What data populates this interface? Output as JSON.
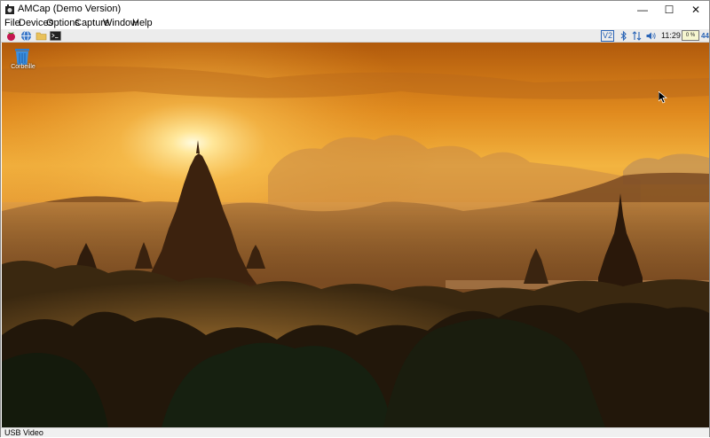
{
  "window": {
    "title": "AMCap (Demo Version)",
    "minimize_glyph": "—",
    "maximize_glyph": "☐",
    "close_glyph": "✕"
  },
  "menu": {
    "items": [
      {
        "label": "File"
      },
      {
        "label": "Devices"
      },
      {
        "label": "Options"
      },
      {
        "label": "Capture"
      },
      {
        "label": "Window"
      },
      {
        "label": "Help"
      }
    ]
  },
  "taskbar": {
    "launchers": [
      "raspberry-icon",
      "globe-icon",
      "folder-icon",
      "terminal-icon"
    ],
    "tray": {
      "vnc_label": "V2",
      "clock": "11:29",
      "cpu": "0 %",
      "extra": "44"
    }
  },
  "desktop": {
    "trash_label": "Corbeille"
  },
  "status": {
    "text": "USB Video"
  },
  "colors": {
    "sky_top": "#c2660f",
    "sun": "#fff6c8",
    "mountains": "#6b3d18",
    "foreground": "#1a1208",
    "accent_blue": "#2a64b6"
  }
}
